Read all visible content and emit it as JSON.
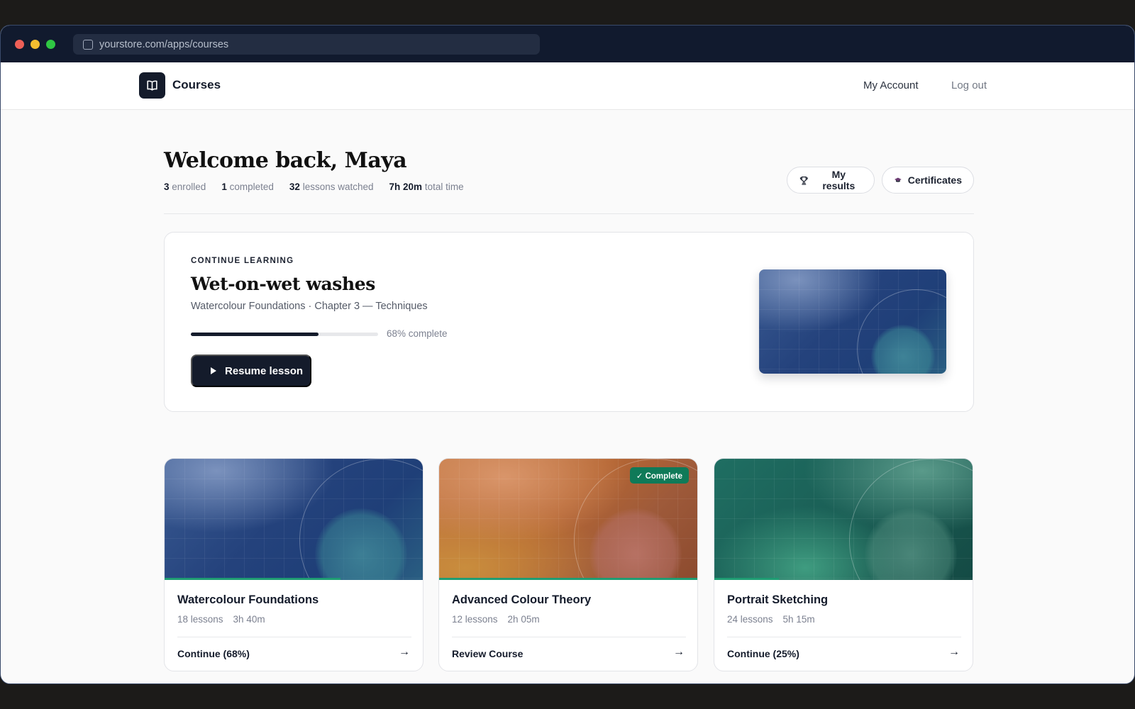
{
  "browser": {
    "url": "yourstore.com/apps/courses"
  },
  "header": {
    "brand": "Courses",
    "nav": {
      "account": "My Account",
      "logout": "Log out"
    }
  },
  "welcome": {
    "title": "Welcome back, Maya",
    "stats": [
      {
        "value": "3",
        "label": "enrolled"
      },
      {
        "value": "1",
        "label": "completed"
      },
      {
        "value": "32",
        "label": "lessons watched"
      },
      {
        "value": "7h 20m",
        "label": "total time"
      }
    ],
    "actions": {
      "results": "My results",
      "certificates": "Certificates"
    }
  },
  "continue": {
    "eyebrow": "CONTINUE LEARNING",
    "title": "Wet-on-wet washes",
    "subtitle": "Watercolour Foundations · Chapter 3 — Techniques",
    "progress": 68,
    "progress_label": "68% complete",
    "button": "Resume lesson"
  },
  "courses": [
    {
      "title": "Watercolour Foundations",
      "lessons": "18 lessons",
      "duration": "3h 40m",
      "action": "Continue (68%)",
      "progress": 68,
      "theme": "blue",
      "badge": ""
    },
    {
      "title": "Advanced Colour Theory",
      "lessons": "12 lessons",
      "duration": "2h 05m",
      "action": "Review Course",
      "progress": 100,
      "theme": "orange",
      "badge": "✓ Complete"
    },
    {
      "title": "Portrait Sketching",
      "lessons": "24 lessons",
      "duration": "5h 15m",
      "action": "Continue (25%)",
      "progress": 25,
      "theme": "teal",
      "badge": ""
    }
  ],
  "colors": {
    "primary": "#141b2b",
    "success": "#0f7a58",
    "progress_bar": "#1f9d73"
  }
}
